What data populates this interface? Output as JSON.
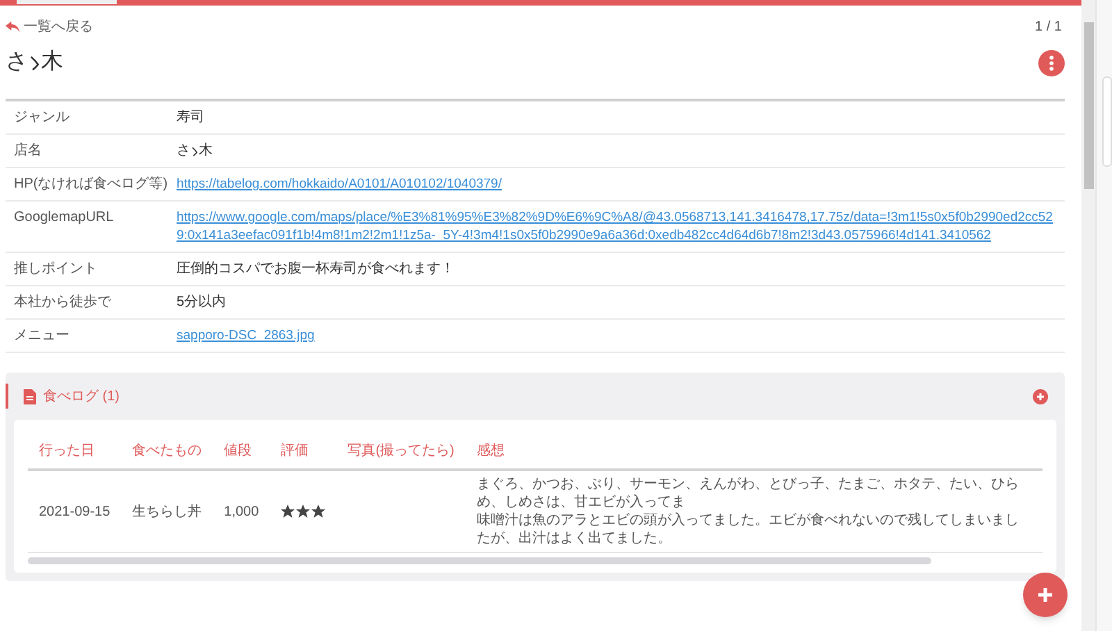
{
  "back_link": "一覧へ戻る",
  "pager": "1 / 1",
  "title": [
    {
      "kind": "text",
      "text": "さ"
    },
    {
      "kind": "repeat_mark"
    },
    {
      "kind": "text",
      "text": "木"
    }
  ],
  "details": [
    {
      "label": "ジャンル",
      "value": "寿司",
      "kind": "text"
    },
    {
      "label": "店名",
      "value": [
        {
          "kind": "text",
          "text": "さ"
        },
        {
          "kind": "repeat_mark"
        },
        {
          "kind": "text",
          "text": "木"
        }
      ],
      "kind": "parts"
    },
    {
      "label": "HP(なければ食べログ等)",
      "value": "https://tabelog.com/hokkaido/A0101/A010102/1040379/",
      "kind": "link"
    },
    {
      "label": "GooglemapURL",
      "value": "https://www.google.com/maps/place/%E3%81%95%E3%82%9D%E6%9C%A8/@43.0568713,141.3416478,17.75z/data=!3m1!5s0x5f0b2990ed2cc529:0x141a3eefac091f1b!4m8!1m2!2m1!1z5a-_5Y-4!3m4!1s0x5f0b2990e9a6a36d:0xedb482cc4d64d6b7!8m2!3d43.0575966!4d141.3410562",
      "kind": "link"
    },
    {
      "label": "推しポイント",
      "value": "圧倒的コスパでお腹一杯寿司が食べれます！",
      "kind": "text"
    },
    {
      "label": "本社から徒歩で",
      "value": "5分以内",
      "kind": "text"
    },
    {
      "label": "メニュー",
      "value": "sapporo-DSC_2863.jpg",
      "kind": "link"
    }
  ],
  "section": {
    "title": "食べログ (1)",
    "columns": [
      "行った日",
      "食べたもの",
      "値段",
      "評価",
      "写真(撮ってたら)",
      "感想"
    ],
    "rows": [
      {
        "date": "2021-09-15",
        "food": "生ちらし丼",
        "price": "1,000",
        "stars": 3,
        "comment": [
          "まぐろ、かつお、ぶり、サーモン、えんがわ、とびっ子、たまご、ホタテ、たい、ひらめ、しめさは、甘エビが入ってま",
          "味噌汁は魚のアラとエビの頭が入ってました。エビが食べれないので残してしまいましたが、出汁はよく出てました。"
        ]
      }
    ]
  }
}
